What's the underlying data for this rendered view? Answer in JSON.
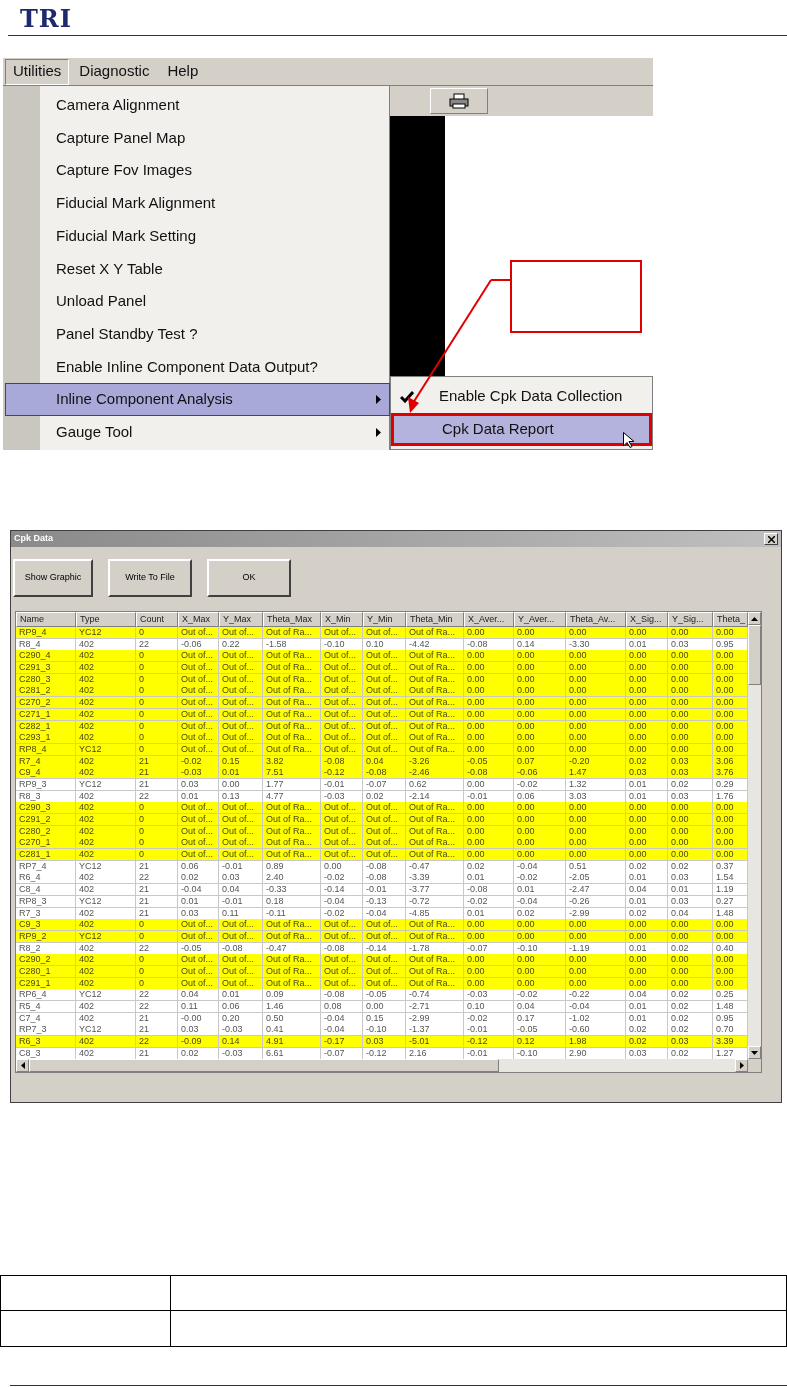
{
  "header": {
    "logo": "TRI"
  },
  "menu_screenshot": {
    "menubar": [
      {
        "label": "Utilities",
        "selected": true
      },
      {
        "label": "Diagnostic",
        "selected": false
      },
      {
        "label": "Help",
        "selected": false
      }
    ],
    "items": [
      {
        "label": "Camera Alignment",
        "selected": false,
        "submenu": false
      },
      {
        "label": "Capture Panel Map",
        "selected": false,
        "submenu": false
      },
      {
        "label": "Capture  Fov Images",
        "selected": false,
        "submenu": false
      },
      {
        "label": "Fiducial Mark  Alignment",
        "selected": false,
        "submenu": false
      },
      {
        "label": "Fiducial Mark Setting",
        "selected": false,
        "submenu": false
      },
      {
        "label": "Reset X Y Table",
        "selected": false,
        "submenu": false
      },
      {
        "label": "Unload Panel",
        "selected": false,
        "submenu": false
      },
      {
        "label": "Panel Standby Test ?",
        "selected": false,
        "submenu": false
      },
      {
        "label": "Enable Inline Component Data Output?",
        "selected": false,
        "submenu": false
      },
      {
        "label": "Inline Component Analysis",
        "selected": true,
        "submenu": true
      },
      {
        "label": "Gauge Tool",
        "selected": false,
        "submenu": true
      }
    ],
    "submenu": [
      {
        "label": "Enable Cpk Data Collection",
        "checked": true,
        "selected": false
      },
      {
        "label": "Cpk Data Report",
        "checked": false,
        "selected": true
      }
    ]
  },
  "dialog": {
    "title": "Cpk Data",
    "buttons": [
      "Show Graphic",
      "Write To File",
      "OK"
    ],
    "table": {
      "columns": [
        "Name",
        "Type",
        "Count",
        "X_Max",
        "Y_Max",
        "Theta_Max",
        "X_Min",
        "Y_Min",
        "Theta_Min",
        "X_Aver...",
        "Y_Aver...",
        "Theta_Av...",
        "X_Sig...",
        "Y_Sig...",
        "Theta_"
      ],
      "rows": [
        {
          "highlighted": true,
          "cells": [
            "RP9_4",
            "YC12",
            "0",
            "Out of...",
            "Out of...",
            "Out of Ra...",
            "Out of...",
            "Out of...",
            "Out of Ra...",
            "0.00",
            "0.00",
            "0.00",
            "0.00",
            "0.00",
            "0.00"
          ]
        },
        {
          "highlighted": false,
          "cells": [
            "R8_4",
            "402",
            "22",
            "-0.06",
            "0.22",
            "-1.58",
            "-0.10",
            "0.10",
            "-4.42",
            "-0.08",
            "0.14",
            "-3.30",
            "0.01",
            "0.03",
            "0.95"
          ]
        },
        {
          "highlighted": true,
          "cells": [
            "C290_4",
            "402",
            "0",
            "Out of...",
            "Out of...",
            "Out of Ra...",
            "Out of...",
            "Out of...",
            "Out of Ra...",
            "0.00",
            "0.00",
            "0.00",
            "0.00",
            "0.00",
            "0.00"
          ]
        },
        {
          "highlighted": true,
          "cells": [
            "C291_3",
            "402",
            "0",
            "Out of...",
            "Out of...",
            "Out of Ra...",
            "Out of...",
            "Out of...",
            "Out of Ra...",
            "0.00",
            "0.00",
            "0.00",
            "0.00",
            "0.00",
            "0.00"
          ]
        },
        {
          "highlighted": true,
          "cells": [
            "C280_3",
            "402",
            "0",
            "Out of...",
            "Out of...",
            "Out of Ra...",
            "Out of...",
            "Out of...",
            "Out of Ra...",
            "0.00",
            "0.00",
            "0.00",
            "0.00",
            "0.00",
            "0.00"
          ]
        },
        {
          "highlighted": true,
          "cells": [
            "C281_2",
            "402",
            "0",
            "Out of...",
            "Out of...",
            "Out of Ra...",
            "Out of...",
            "Out of...",
            "Out of Ra...",
            "0.00",
            "0.00",
            "0.00",
            "0.00",
            "0.00",
            "0.00"
          ]
        },
        {
          "highlighted": true,
          "cells": [
            "C270_2",
            "402",
            "0",
            "Out of...",
            "Out of...",
            "Out of Ra...",
            "Out of...",
            "Out of...",
            "Out of Ra...",
            "0.00",
            "0.00",
            "0.00",
            "0.00",
            "0.00",
            "0.00"
          ]
        },
        {
          "highlighted": true,
          "cells": [
            "C271_1",
            "402",
            "0",
            "Out of...",
            "Out of...",
            "Out of Ra...",
            "Out of...",
            "Out of...",
            "Out of Ra...",
            "0.00",
            "0.00",
            "0.00",
            "0.00",
            "0.00",
            "0.00"
          ]
        },
        {
          "highlighted": true,
          "cells": [
            "C282_1",
            "402",
            "0",
            "Out of...",
            "Out of...",
            "Out of Ra...",
            "Out of...",
            "Out of...",
            "Out of Ra...",
            "0.00",
            "0.00",
            "0.00",
            "0.00",
            "0.00",
            "0.00"
          ]
        },
        {
          "highlighted": true,
          "cells": [
            "C293_1",
            "402",
            "0",
            "Out of...",
            "Out of...",
            "Out of Ra...",
            "Out of...",
            "Out of...",
            "Out of Ra...",
            "0.00",
            "0.00",
            "0.00",
            "0.00",
            "0.00",
            "0.00"
          ]
        },
        {
          "highlighted": true,
          "cells": [
            "RP8_4",
            "YC12",
            "0",
            "Out of...",
            "Out of...",
            "Out of Ra...",
            "Out of...",
            "Out of...",
            "Out of Ra...",
            "0.00",
            "0.00",
            "0.00",
            "0.00",
            "0.00",
            "0.00"
          ]
        },
        {
          "highlighted": true,
          "cells": [
            "R7_4",
            "402",
            "21",
            "-0.02",
            "0.15",
            "3.82",
            "-0.08",
            "0.04",
            "-3.26",
            "-0.05",
            "0.07",
            "-0.20",
            "0.02",
            "0.03",
            "3.06"
          ]
        },
        {
          "highlighted": true,
          "cells": [
            "C9_4",
            "402",
            "21",
            "-0.03",
            "0.01",
            "7.51",
            "-0.12",
            "-0.08",
            "-2.46",
            "-0.08",
            "-0.06",
            "1.47",
            "0.03",
            "0.03",
            "3.76"
          ]
        },
        {
          "highlighted": false,
          "cells": [
            "RP9_3",
            "YC12",
            "21",
            "0.03",
            "0.00",
            "1.77",
            "-0.01",
            "-0.07",
            "0.62",
            "0.00",
            "-0.02",
            "1.32",
            "0.01",
            "0.02",
            "0.29"
          ]
        },
        {
          "highlighted": false,
          "cells": [
            "R8_3",
            "402",
            "22",
            "0.01",
            "0.13",
            "4.77",
            "-0.03",
            "0.02",
            "-2.14",
            "-0.01",
            "0.06",
            "3.03",
            "0.01",
            "0.03",
            "1.76"
          ]
        },
        {
          "highlighted": true,
          "cells": [
            "C290_3",
            "402",
            "0",
            "Out of...",
            "Out of...",
            "Out of Ra...",
            "Out of...",
            "Out of...",
            "Out of Ra...",
            "0.00",
            "0.00",
            "0.00",
            "0.00",
            "0.00",
            "0.00"
          ]
        },
        {
          "highlighted": true,
          "cells": [
            "C291_2",
            "402",
            "0",
            "Out of...",
            "Out of...",
            "Out of Ra...",
            "Out of...",
            "Out of...",
            "Out of Ra...",
            "0.00",
            "0.00",
            "0.00",
            "0.00",
            "0.00",
            "0.00"
          ]
        },
        {
          "highlighted": true,
          "cells": [
            "C280_2",
            "402",
            "0",
            "Out of...",
            "Out of...",
            "Out of Ra...",
            "Out of...",
            "Out of...",
            "Out of Ra...",
            "0.00",
            "0.00",
            "0.00",
            "0.00",
            "0.00",
            "0.00"
          ]
        },
        {
          "highlighted": true,
          "cells": [
            "C270_1",
            "402",
            "0",
            "Out of...",
            "Out of...",
            "Out of Ra...",
            "Out of...",
            "Out of...",
            "Out of Ra...",
            "0.00",
            "0.00",
            "0.00",
            "0.00",
            "0.00",
            "0.00"
          ]
        },
        {
          "highlighted": true,
          "cells": [
            "C281_1",
            "402",
            "0",
            "Out of...",
            "Out of...",
            "Out of Ra...",
            "Out of...",
            "Out of...",
            "Out of Ra...",
            "0.00",
            "0.00",
            "0.00",
            "0.00",
            "0.00",
            "0.00"
          ]
        },
        {
          "highlighted": false,
          "cells": [
            "RP7_4",
            "YC12",
            "21",
            "0.06",
            "-0.01",
            "0.89",
            "0.00",
            "-0.08",
            "-0.47",
            "0.02",
            "-0.04",
            "0.51",
            "0.02",
            "0.02",
            "0.37"
          ]
        },
        {
          "highlighted": false,
          "cells": [
            "R6_4",
            "402",
            "22",
            "0.02",
            "0.03",
            "2.40",
            "-0.02",
            "-0.08",
            "-3.39",
            "0.01",
            "-0.02",
            "-2.05",
            "0.01",
            "0.03",
            "1.54"
          ]
        },
        {
          "highlighted": false,
          "cells": [
            "C8_4",
            "402",
            "21",
            "-0.04",
            "0.04",
            "-0.33",
            "-0.14",
            "-0.01",
            "-3.77",
            "-0.08",
            "0.01",
            "-2.47",
            "0.04",
            "0.01",
            "1.19"
          ]
        },
        {
          "highlighted": false,
          "cells": [
            "RP8_3",
            "YC12",
            "21",
            "0.01",
            "-0.01",
            "0.18",
            "-0.04",
            "-0.13",
            "-0.72",
            "-0.02",
            "-0.04",
            "-0.26",
            "0.01",
            "0.03",
            "0.27"
          ]
        },
        {
          "highlighted": false,
          "cells": [
            "R7_3",
            "402",
            "21",
            "0.03",
            "0.11",
            "-0.11",
            "-0.02",
            "-0.04",
            "-4.85",
            "0.01",
            "0.02",
            "-2.99",
            "0.02",
            "0.04",
            "1.48"
          ]
        },
        {
          "highlighted": true,
          "cells": [
            "C9_3",
            "402",
            "0",
            "Out of...",
            "Out of...",
            "Out of Ra...",
            "Out of...",
            "Out of...",
            "Out of Ra...",
            "0.00",
            "0.00",
            "0.00",
            "0.00",
            "0.00",
            "0.00"
          ]
        },
        {
          "highlighted": true,
          "cells": [
            "RP9_2",
            "YC12",
            "0",
            "Out of...",
            "Out of...",
            "Out of Ra...",
            "Out of...",
            "Out of...",
            "Out of Ra...",
            "0.00",
            "0.00",
            "0.00",
            "0.00",
            "0.00",
            "0.00"
          ]
        },
        {
          "highlighted": false,
          "cells": [
            "R8_2",
            "402",
            "22",
            "-0.05",
            "-0.08",
            "-0.47",
            "-0.08",
            "-0.14",
            "-1.78",
            "-0.07",
            "-0.10",
            "-1.19",
            "0.01",
            "0.02",
            "0.40"
          ]
        },
        {
          "highlighted": true,
          "cells": [
            "C290_2",
            "402",
            "0",
            "Out of...",
            "Out of...",
            "Out of Ra...",
            "Out of...",
            "Out of...",
            "Out of Ra...",
            "0.00",
            "0.00",
            "0.00",
            "0.00",
            "0.00",
            "0.00"
          ]
        },
        {
          "highlighted": true,
          "cells": [
            "C280_1",
            "402",
            "0",
            "Out of...",
            "Out of...",
            "Out of Ra...",
            "Out of...",
            "Out of...",
            "Out of Ra...",
            "0.00",
            "0.00",
            "0.00",
            "0.00",
            "0.00",
            "0.00"
          ]
        },
        {
          "highlighted": true,
          "cells": [
            "C291_1",
            "402",
            "0",
            "Out of...",
            "Out of...",
            "Out of Ra...",
            "Out of...",
            "Out of...",
            "Out of Ra...",
            "0.00",
            "0.00",
            "0.00",
            "0.00",
            "0.00",
            "0.00"
          ]
        },
        {
          "highlighted": false,
          "cells": [
            "RP6_4",
            "YC12",
            "22",
            "0.04",
            "0.01",
            "0.09",
            "-0.08",
            "-0.05",
            "-0.74",
            "-0.03",
            "-0.02",
            "-0.22",
            "0.04",
            "0.02",
            "0.25"
          ]
        },
        {
          "highlighted": false,
          "cells": [
            "R5_4",
            "402",
            "22",
            "0.11",
            "0.06",
            "1.46",
            "0.08",
            "0.00",
            "-2.71",
            "0.10",
            "0.04",
            "-0.04",
            "0.01",
            "0.02",
            "1.48"
          ]
        },
        {
          "highlighted": false,
          "cells": [
            "C7_4",
            "402",
            "21",
            "-0.00",
            "0.20",
            "0.50",
            "-0.04",
            "0.15",
            "-2.99",
            "-0.02",
            "0.17",
            "-1.02",
            "0.01",
            "0.02",
            "0.95"
          ]
        },
        {
          "highlighted": false,
          "cells": [
            "RP7_3",
            "YC12",
            "21",
            "0.03",
            "-0.03",
            "0.41",
            "-0.04",
            "-0.10",
            "-1.37",
            "-0.01",
            "-0.05",
            "-0.60",
            "0.02",
            "0.02",
            "0.70"
          ]
        },
        {
          "highlighted": true,
          "cells": [
            "R6_3",
            "402",
            "22",
            "-0.09",
            "0.14",
            "4.91",
            "-0.17",
            "0.03",
            "-5.01",
            "-0.12",
            "0.12",
            "1.98",
            "0.02",
            "0.03",
            "3.39"
          ]
        },
        {
          "highlighted": false,
          "cells": [
            "C8_3",
            "402",
            "21",
            "0.02",
            "-0.03",
            "6.61",
            "-0.07",
            "-0.12",
            "2.16",
            "-0.01",
            "-0.10",
            "2.90",
            "0.03",
            "0.02",
            "1.27"
          ]
        }
      ]
    }
  }
}
